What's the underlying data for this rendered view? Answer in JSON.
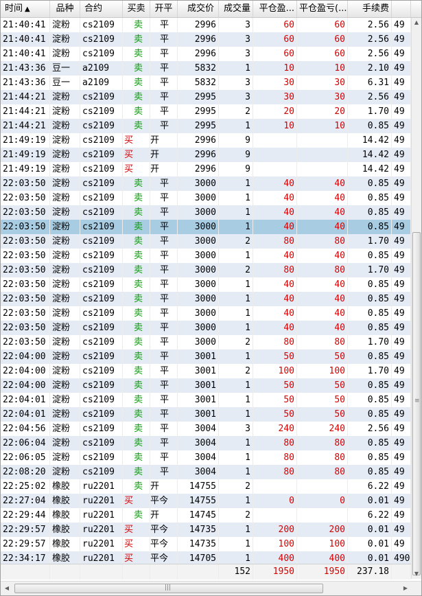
{
  "columns": [
    "时间",
    "品种",
    "合约",
    "买卖",
    "开平",
    "成交价",
    "成交量",
    "平仓盈...",
    "平仓盈亏(...",
    "手续费",
    ""
  ],
  "sort_indicator": "▲",
  "colors": {
    "buy": "#d40000",
    "sell": "#0a9a0a",
    "profit": "#d40000",
    "selected_row": "#a8cde3",
    "alt_row": "#e4ebf5"
  },
  "selected_index": 14,
  "rows": [
    {
      "time": "21:40:41",
      "product": "淀粉",
      "contract": "cs2109",
      "side": "卖",
      "oc": "平",
      "price": "2996",
      "qty": "3",
      "pnl1": "60",
      "pnl2": "60",
      "fee": "2.56",
      "extra": "49"
    },
    {
      "time": "21:40:41",
      "product": "淀粉",
      "contract": "cs2109",
      "side": "卖",
      "oc": "平",
      "price": "2996",
      "qty": "3",
      "pnl1": "60",
      "pnl2": "60",
      "fee": "2.56",
      "extra": "49"
    },
    {
      "time": "21:40:41",
      "product": "淀粉",
      "contract": "cs2109",
      "side": "卖",
      "oc": "平",
      "price": "2996",
      "qty": "3",
      "pnl1": "60",
      "pnl2": "60",
      "fee": "2.56",
      "extra": "49"
    },
    {
      "time": "21:43:36",
      "product": "豆一",
      "contract": "a2109",
      "side": "卖",
      "oc": "平",
      "price": "5832",
      "qty": "1",
      "pnl1": "10",
      "pnl2": "10",
      "fee": "2.10",
      "extra": "49"
    },
    {
      "time": "21:43:36",
      "product": "豆一",
      "contract": "a2109",
      "side": "卖",
      "oc": "平",
      "price": "5832",
      "qty": "3",
      "pnl1": "30",
      "pnl2": "30",
      "fee": "6.31",
      "extra": "49"
    },
    {
      "time": "21:44:21",
      "product": "淀粉",
      "contract": "cs2109",
      "side": "卖",
      "oc": "平",
      "price": "2995",
      "qty": "3",
      "pnl1": "30",
      "pnl2": "30",
      "fee": "2.56",
      "extra": "49"
    },
    {
      "time": "21:44:21",
      "product": "淀粉",
      "contract": "cs2109",
      "side": "卖",
      "oc": "平",
      "price": "2995",
      "qty": "2",
      "pnl1": "20",
      "pnl2": "20",
      "fee": "1.70",
      "extra": "49"
    },
    {
      "time": "21:44:21",
      "product": "淀粉",
      "contract": "cs2109",
      "side": "卖",
      "oc": "平",
      "price": "2995",
      "qty": "1",
      "pnl1": "10",
      "pnl2": "10",
      "fee": "0.85",
      "extra": "49"
    },
    {
      "time": "21:49:19",
      "product": "淀粉",
      "contract": "cs2109",
      "side": "买",
      "oc": "开",
      "price": "2996",
      "qty": "9",
      "pnl1": "",
      "pnl2": "",
      "fee": "14.42",
      "extra": "49"
    },
    {
      "time": "21:49:19",
      "product": "淀粉",
      "contract": "cs2109",
      "side": "买",
      "oc": "开",
      "price": "2996",
      "qty": "9",
      "pnl1": "",
      "pnl2": "",
      "fee": "14.42",
      "extra": "49"
    },
    {
      "time": "21:49:19",
      "product": "淀粉",
      "contract": "cs2109",
      "side": "买",
      "oc": "开",
      "price": "2996",
      "qty": "9",
      "pnl1": "",
      "pnl2": "",
      "fee": "14.42",
      "extra": "49"
    },
    {
      "time": "22:03:50",
      "product": "淀粉",
      "contract": "cs2109",
      "side": "卖",
      "oc": "平",
      "price": "3000",
      "qty": "1",
      "pnl1": "40",
      "pnl2": "40",
      "fee": "0.85",
      "extra": "49"
    },
    {
      "time": "22:03:50",
      "product": "淀粉",
      "contract": "cs2109",
      "side": "卖",
      "oc": "平",
      "price": "3000",
      "qty": "1",
      "pnl1": "40",
      "pnl2": "40",
      "fee": "0.85",
      "extra": "49"
    },
    {
      "time": "22:03:50",
      "product": "淀粉",
      "contract": "cs2109",
      "side": "卖",
      "oc": "平",
      "price": "3000",
      "qty": "1",
      "pnl1": "40",
      "pnl2": "40",
      "fee": "0.85",
      "extra": "49"
    },
    {
      "time": "22:03:50",
      "product": "淀粉",
      "contract": "cs2109",
      "side": "卖",
      "oc": "平",
      "price": "3000",
      "qty": "1",
      "pnl1": "40",
      "pnl2": "40",
      "fee": "0.85",
      "extra": "49"
    },
    {
      "time": "22:03:50",
      "product": "淀粉",
      "contract": "cs2109",
      "side": "卖",
      "oc": "平",
      "price": "3000",
      "qty": "2",
      "pnl1": "80",
      "pnl2": "80",
      "fee": "1.70",
      "extra": "49"
    },
    {
      "time": "22:03:50",
      "product": "淀粉",
      "contract": "cs2109",
      "side": "卖",
      "oc": "平",
      "price": "3000",
      "qty": "1",
      "pnl1": "40",
      "pnl2": "40",
      "fee": "0.85",
      "extra": "49"
    },
    {
      "time": "22:03:50",
      "product": "淀粉",
      "contract": "cs2109",
      "side": "卖",
      "oc": "平",
      "price": "3000",
      "qty": "2",
      "pnl1": "80",
      "pnl2": "80",
      "fee": "1.70",
      "extra": "49"
    },
    {
      "time": "22:03:50",
      "product": "淀粉",
      "contract": "cs2109",
      "side": "卖",
      "oc": "平",
      "price": "3000",
      "qty": "1",
      "pnl1": "40",
      "pnl2": "40",
      "fee": "0.85",
      "extra": "49"
    },
    {
      "time": "22:03:50",
      "product": "淀粉",
      "contract": "cs2109",
      "side": "卖",
      "oc": "平",
      "price": "3000",
      "qty": "1",
      "pnl1": "40",
      "pnl2": "40",
      "fee": "0.85",
      "extra": "49"
    },
    {
      "time": "22:03:50",
      "product": "淀粉",
      "contract": "cs2109",
      "side": "卖",
      "oc": "平",
      "price": "3000",
      "qty": "1",
      "pnl1": "40",
      "pnl2": "40",
      "fee": "0.85",
      "extra": "49"
    },
    {
      "time": "22:03:50",
      "product": "淀粉",
      "contract": "cs2109",
      "side": "卖",
      "oc": "平",
      "price": "3000",
      "qty": "1",
      "pnl1": "40",
      "pnl2": "40",
      "fee": "0.85",
      "extra": "49"
    },
    {
      "time": "22:03:50",
      "product": "淀粉",
      "contract": "cs2109",
      "side": "卖",
      "oc": "平",
      "price": "3000",
      "qty": "2",
      "pnl1": "80",
      "pnl2": "80",
      "fee": "1.70",
      "extra": "49"
    },
    {
      "time": "22:04:00",
      "product": "淀粉",
      "contract": "cs2109",
      "side": "卖",
      "oc": "平",
      "price": "3001",
      "qty": "1",
      "pnl1": "50",
      "pnl2": "50",
      "fee": "0.85",
      "extra": "49"
    },
    {
      "time": "22:04:00",
      "product": "淀粉",
      "contract": "cs2109",
      "side": "卖",
      "oc": "平",
      "price": "3001",
      "qty": "2",
      "pnl1": "100",
      "pnl2": "100",
      "fee": "1.70",
      "extra": "49"
    },
    {
      "time": "22:04:00",
      "product": "淀粉",
      "contract": "cs2109",
      "side": "卖",
      "oc": "平",
      "price": "3001",
      "qty": "1",
      "pnl1": "50",
      "pnl2": "50",
      "fee": "0.85",
      "extra": "49"
    },
    {
      "time": "22:04:01",
      "product": "淀粉",
      "contract": "cs2109",
      "side": "卖",
      "oc": "平",
      "price": "3001",
      "qty": "1",
      "pnl1": "50",
      "pnl2": "50",
      "fee": "0.85",
      "extra": "49"
    },
    {
      "time": "22:04:01",
      "product": "淀粉",
      "contract": "cs2109",
      "side": "卖",
      "oc": "平",
      "price": "3001",
      "qty": "1",
      "pnl1": "50",
      "pnl2": "50",
      "fee": "0.85",
      "extra": "49"
    },
    {
      "time": "22:04:56",
      "product": "淀粉",
      "contract": "cs2109",
      "side": "卖",
      "oc": "平",
      "price": "3004",
      "qty": "3",
      "pnl1": "240",
      "pnl2": "240",
      "fee": "2.56",
      "extra": "49"
    },
    {
      "time": "22:06:04",
      "product": "淀粉",
      "contract": "cs2109",
      "side": "卖",
      "oc": "平",
      "price": "3004",
      "qty": "1",
      "pnl1": "80",
      "pnl2": "80",
      "fee": "0.85",
      "extra": "49"
    },
    {
      "time": "22:06:05",
      "product": "淀粉",
      "contract": "cs2109",
      "side": "卖",
      "oc": "平",
      "price": "3004",
      "qty": "1",
      "pnl1": "80",
      "pnl2": "80",
      "fee": "0.85",
      "extra": "49"
    },
    {
      "time": "22:08:20",
      "product": "淀粉",
      "contract": "cs2109",
      "side": "卖",
      "oc": "平",
      "price": "3004",
      "qty": "1",
      "pnl1": "80",
      "pnl2": "80",
      "fee": "0.85",
      "extra": "49"
    },
    {
      "time": "22:25:02",
      "product": "橡胶",
      "contract": "ru2201",
      "side": "卖",
      "oc": "开",
      "price": "14755",
      "qty": "2",
      "pnl1": "",
      "pnl2": "",
      "fee": "6.22",
      "extra": "49"
    },
    {
      "time": "22:27:04",
      "product": "橡胶",
      "contract": "ru2201",
      "side": "买",
      "oc": "平今",
      "price": "14755",
      "qty": "1",
      "pnl1": "0",
      "pnl2": "0",
      "fee": "0.01",
      "extra": "49"
    },
    {
      "time": "22:29:44",
      "product": "橡胶",
      "contract": "ru2201",
      "side": "卖",
      "oc": "开",
      "price": "14745",
      "qty": "2",
      "pnl1": "",
      "pnl2": "",
      "fee": "6.22",
      "extra": "49"
    },
    {
      "time": "22:29:57",
      "product": "橡胶",
      "contract": "ru2201",
      "side": "买",
      "oc": "平今",
      "price": "14735",
      "qty": "1",
      "pnl1": "200",
      "pnl2": "200",
      "fee": "0.01",
      "extra": "49"
    },
    {
      "time": "22:29:57",
      "product": "橡胶",
      "contract": "ru2201",
      "side": "买",
      "oc": "平今",
      "price": "14735",
      "qty": "1",
      "pnl1": "100",
      "pnl2": "100",
      "fee": "0.01",
      "extra": "49"
    },
    {
      "time": "22:34:17",
      "product": "橡胶",
      "contract": "ru2201",
      "side": "买",
      "oc": "平今",
      "price": "14705",
      "qty": "1",
      "pnl1": "400",
      "pnl2": "400",
      "fee": "0.01",
      "extra": "490"
    }
  ],
  "totals": {
    "qty": "152",
    "pnl1": "1950",
    "pnl2": "1950",
    "fee": "237.18"
  }
}
